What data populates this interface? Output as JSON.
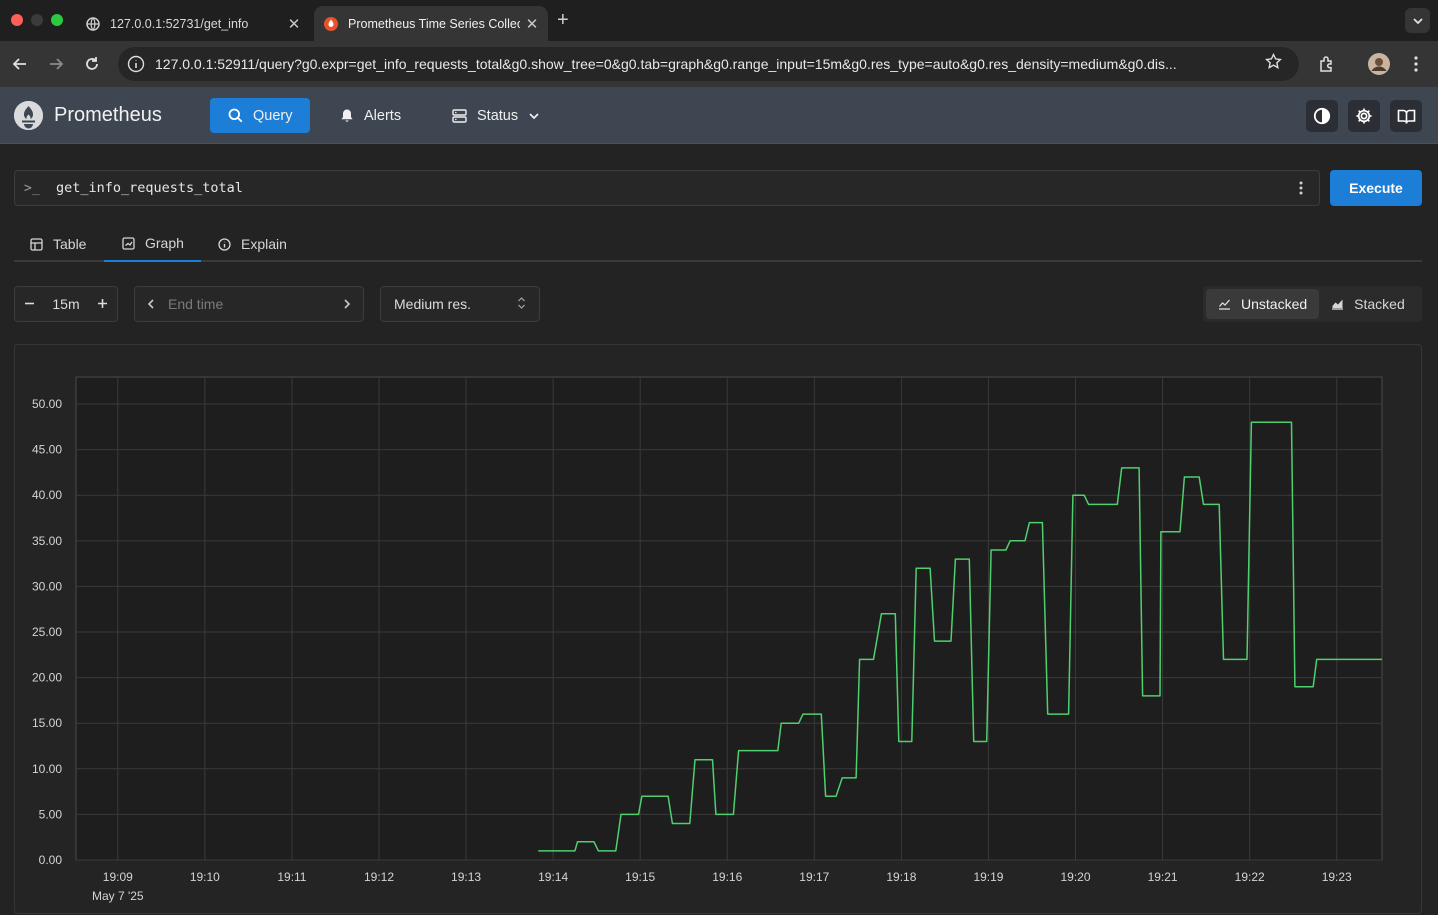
{
  "browser": {
    "tabs": [
      {
        "label": "127.0.0.1:52731/get_info",
        "active": false
      },
      {
        "label": "Prometheus Time Series Collection",
        "active": true
      }
    ],
    "url": "127.0.0.1:52911/query?g0.expr=get_info_requests_total&g0.show_tree=0&g0.tab=graph&g0.range_input=15m&g0.res_type=auto&g0.res_density=medium&g0.dis..."
  },
  "nav": {
    "brand": "Prometheus",
    "items": [
      {
        "label": "Query",
        "icon": "search-icon",
        "active": true
      },
      {
        "label": "Alerts",
        "icon": "bell-icon",
        "active": false
      },
      {
        "label": "Status",
        "icon": "server-icon",
        "active": false
      }
    ],
    "accent": "#1c7ed6"
  },
  "query": {
    "prompt": ">_",
    "expression": "get_info_requests_total",
    "execute_label": "Execute"
  },
  "panel_tabs": [
    {
      "label": "Table",
      "active": false
    },
    {
      "label": "Graph",
      "active": true
    },
    {
      "label": "Explain",
      "active": false
    }
  ],
  "controls": {
    "range": "15m",
    "end_time_placeholder": "End time",
    "resolution": "Medium res.",
    "unstacked_label": "Unstacked",
    "stacked_label": "Stacked",
    "mode": "Unstacked"
  },
  "chart_data": {
    "type": "line",
    "series_color": "#4fcf6e",
    "grid": true,
    "x_ticks": [
      "19:09",
      "19:10",
      "19:11",
      "19:12",
      "19:13",
      "19:14",
      "19:15",
      "19:16",
      "19:17",
      "19:18",
      "19:19",
      "19:20",
      "19:21",
      "19:22",
      "19:23"
    ],
    "x_date_label": "May 7 '25",
    "y_ticks": [
      "0.00",
      "5.00",
      "10.00",
      "15.00",
      "20.00",
      "25.00",
      "30.00",
      "35.00",
      "40.00",
      "45.00",
      "50.00"
    ],
    "ylim": [
      0,
      50
    ],
    "xlim_minutes": [
      8.52,
      23.52
    ],
    "series": [
      {
        "x": [
          13.83,
          14.25,
          14.28,
          14.47,
          14.52,
          14.72,
          14.78,
          14.98,
          15.02,
          15.32,
          15.37,
          15.57,
          15.63,
          15.83,
          15.87,
          16.07,
          16.13,
          16.23,
          16.28,
          16.58,
          16.62,
          16.82,
          16.87,
          17.08,
          17.13,
          17.25,
          17.32,
          17.48,
          17.52,
          17.68,
          17.77,
          17.93,
          17.97,
          18.12,
          18.17,
          18.33,
          18.38,
          18.57,
          18.62,
          18.78,
          18.83,
          18.98,
          19.03,
          19.2,
          19.25,
          19.42,
          19.47,
          19.62,
          19.68,
          19.92,
          19.97,
          20.1,
          20.15,
          20.23,
          20.28,
          20.48,
          20.53,
          20.73,
          20.77,
          20.97,
          20.98,
          21.2,
          21.25,
          21.42,
          21.47,
          21.65,
          21.7,
          21.83,
          21.88,
          21.97,
          22.02,
          22.48,
          22.52,
          22.73,
          22.77,
          22.95,
          23.02,
          23.22,
          23.25,
          23.52
        ],
        "y": [
          1,
          1,
          2,
          2,
          1,
          1,
          5,
          5,
          7,
          7,
          4,
          4,
          11,
          11,
          5,
          5,
          12,
          12,
          12,
          12,
          15,
          15,
          16,
          16,
          7,
          7,
          9,
          9,
          22,
          22,
          27,
          27,
          13,
          13,
          32,
          32,
          24,
          24,
          33,
          33,
          13,
          13,
          34,
          34,
          35,
          35,
          37,
          37,
          16,
          16,
          40,
          40,
          39,
          39,
          39,
          39,
          43,
          43,
          18,
          18,
          36,
          36,
          42,
          42,
          39,
          39,
          22,
          22,
          22,
          22,
          48,
          48,
          19,
          19,
          22,
          22,
          22,
          22,
          22,
          22
        ]
      }
    ]
  }
}
